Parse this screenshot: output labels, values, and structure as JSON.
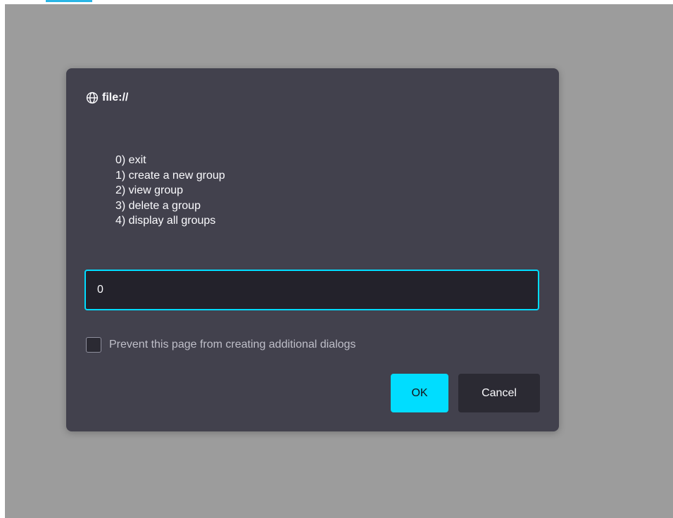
{
  "dialog": {
    "origin": "file://",
    "origin_icon": "globe-icon",
    "message_lines": [
      "0) exit",
      "1) create a new group",
      "2) view group",
      "3) delete a group",
      "4) display all groups"
    ],
    "input_value": "0",
    "checkbox_label": "Prevent this page from creating additional dialogs",
    "ok_label": "OK",
    "cancel_label": "Cancel"
  },
  "colors": {
    "accent": "#00ddff",
    "dialog_bg": "#42414d",
    "overlay": "#9c9c9c"
  }
}
